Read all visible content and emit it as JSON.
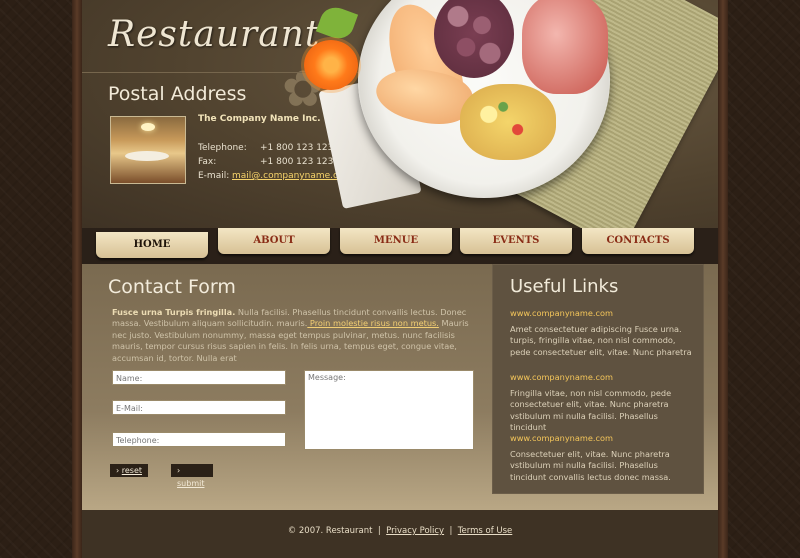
{
  "header": {
    "logo": "Restaurant",
    "postal_title": "Postal Address",
    "company": "The Company Name Inc.",
    "telephone_label": "Telephone:",
    "telephone": "+1 800 123 1234",
    "fax_label": "Fax:",
    "fax": "+1 800 123 1234",
    "email_label": "E-mail:",
    "email": "mail@.companyname.com"
  },
  "nav": {
    "items": [
      "HOME",
      "ABOUT",
      "MENUE",
      "EVENTS",
      "CONTACTS"
    ],
    "active": "HOME"
  },
  "contact": {
    "title": "Contact Form",
    "lead_bold": "Fusce urna Turpis fringilla.",
    "text1": " Nulla facilisi. Phasellus tincidunt convallis lectus. Donec massa. Vestibulum aliquam sollicitudin. mauris.",
    "link": " Proin molestie risus non metus.",
    "text2": " Mauris nec justo. Vestibulum nonummy, massa eget tempus pulvinar, metus.  nunc facilisis mauris, tempor cursus risus sapien in felis. In felis urna, tempus eget, congue vitae, accumsan id, tortor. Nulla erat",
    "name_placeholder": "Name:",
    "email_placeholder": "E-Mail:",
    "telephone_placeholder": "Telephone:",
    "message_placeholder": "Message:",
    "reset_label": "reset",
    "submit_label": "submit"
  },
  "links": {
    "title": "Useful Links",
    "items": [
      {
        "url": "www.companyname.com",
        "text": "Amet consectetuer adipiscing Fusce urna. turpis, fringilla vitae, non nisl commodo, pede consectetuer elit, vitae. Nunc pharetra"
      },
      {
        "url": "www.companyname.com",
        "text": "Fringilla vitae, non nisl commodo, pede consectetuer elit, vitae. Nunc pharetra vstibulum mi nulla facilisi. Phasellus tincidunt"
      },
      {
        "url": "www.companyname.com",
        "text": "Consectetuer elit, vitae. Nunc pharetra vstibulum mi nulla facilisi. Phasellus tincidunt convallis lectus donec massa."
      }
    ]
  },
  "footer": {
    "copyright": "© 2007. Restaurant",
    "sep": "|",
    "privacy": "Privacy Policy",
    "terms": "Terms of Use"
  }
}
